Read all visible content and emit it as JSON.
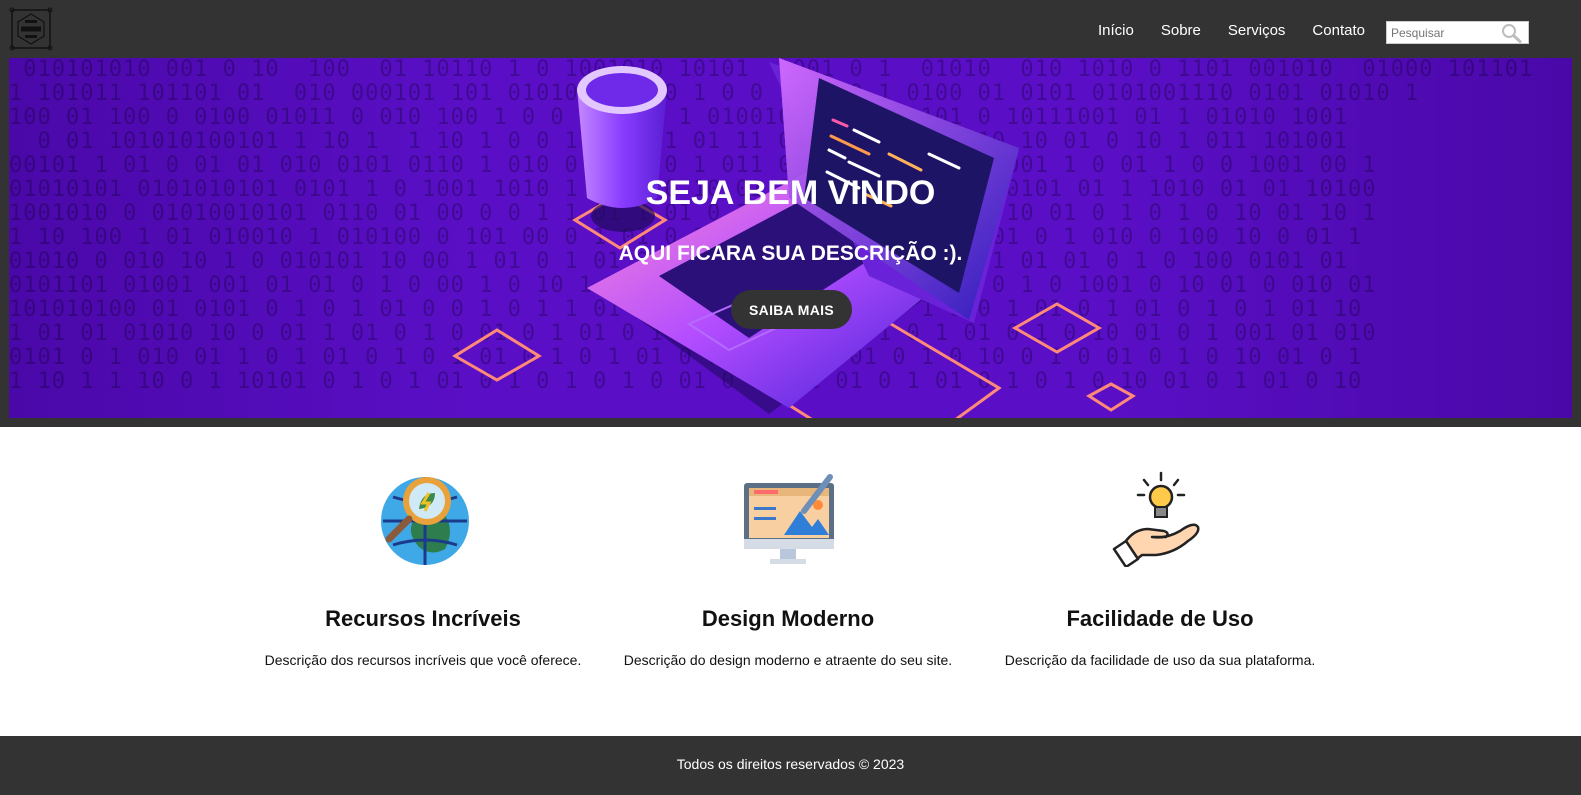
{
  "nav": {
    "logo_icon": "logo-icon",
    "links": [
      {
        "label": "Início"
      },
      {
        "label": "Sobre"
      },
      {
        "label": "Serviços"
      },
      {
        "label": "Contato"
      }
    ],
    "search": {
      "placeholder": "Pesquisar",
      "value": "",
      "icon": "search-icon"
    }
  },
  "hero": {
    "title": "SEJA BEM VINDO",
    "description": "AQUI FICARA SUA DESCRIÇÃO :).",
    "button_label": "SAIBA MAIS",
    "background_color": "#5a0fc6"
  },
  "features": [
    {
      "icon": "globe-magnifier-icon",
      "title": "Recursos Incríveis",
      "description": "Descrição dos recursos incríveis que você oferece."
    },
    {
      "icon": "monitor-design-icon",
      "title": "Design Moderno",
      "description": "Descrição do design moderno e atraente do seu site."
    },
    {
      "icon": "hand-lightbulb-icon",
      "title": "Facilidade de Uso",
      "description": "Descrição da facilidade de uso da sua plataforma."
    }
  ],
  "footer": {
    "text": "Todos os direitos reservados © 2023"
  },
  "colors": {
    "header_bg": "#333333",
    "footer_bg": "#333333",
    "accent": "#5a0fc6"
  }
}
